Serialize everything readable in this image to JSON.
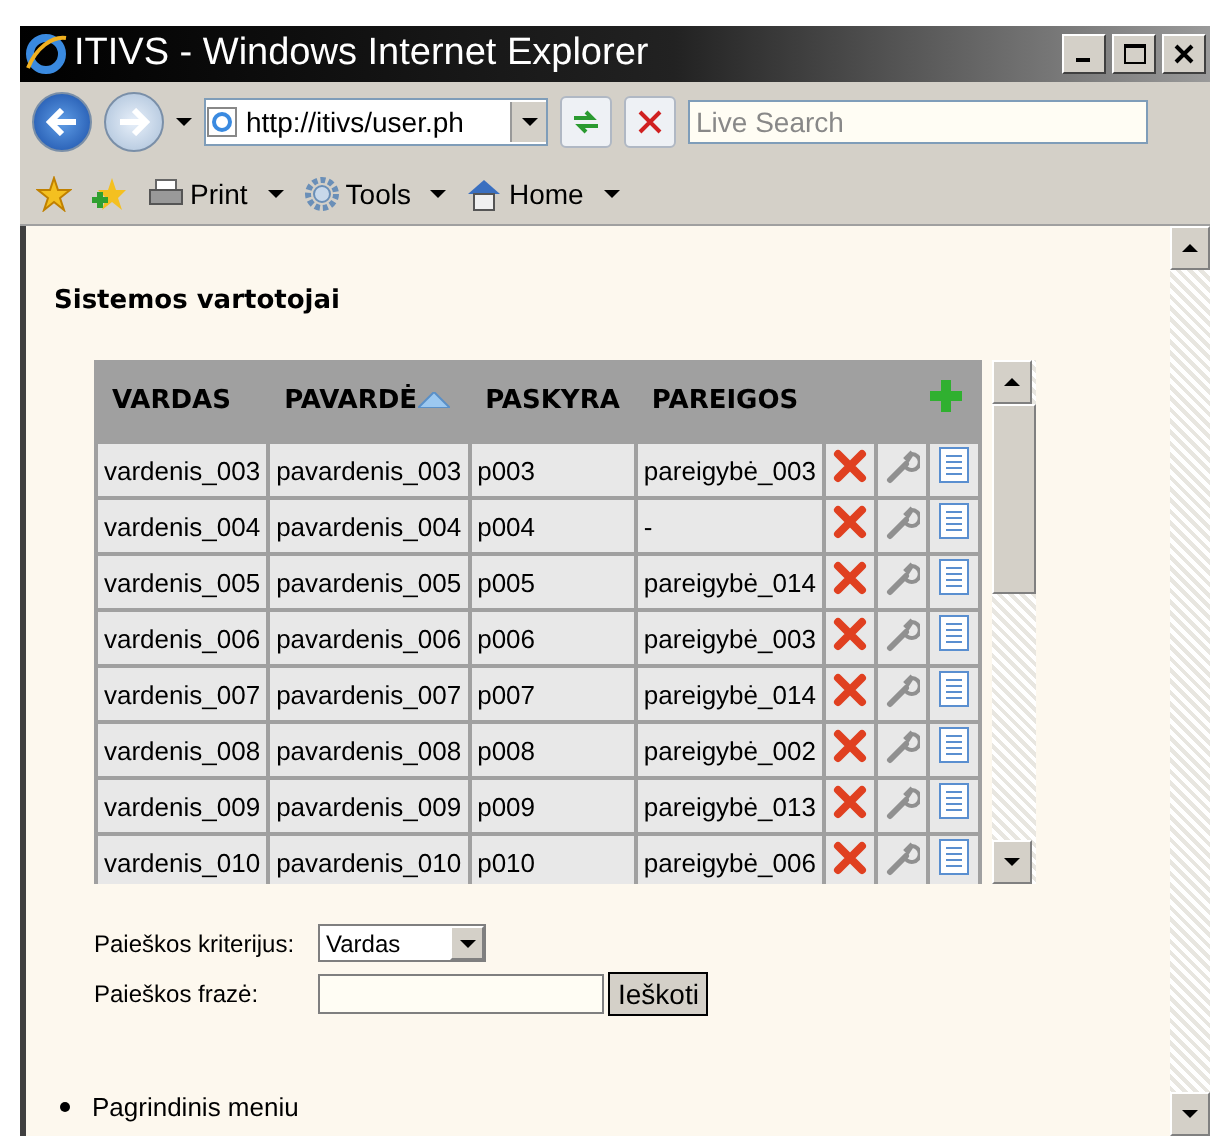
{
  "window": {
    "title": "ITIVS - Windows Internet Explorer"
  },
  "address_bar": {
    "url": "http://itivs/user.ph"
  },
  "search": {
    "placeholder": "Live Search"
  },
  "command_bar": [
    {
      "label": "Print",
      "kind": "print"
    },
    {
      "label": "Tools",
      "kind": "tools"
    },
    {
      "label": "Home",
      "kind": "home"
    }
  ],
  "page": {
    "heading": "Sistemos vartotojai",
    "table": {
      "columns": [
        {
          "label": "VARDAS",
          "sorted": false
        },
        {
          "label": "PAVARDĖ",
          "sorted": true
        },
        {
          "label": "PASKYRA",
          "sorted": false
        },
        {
          "label": "PAREIGOS",
          "sorted": false
        }
      ],
      "rows": [
        [
          "vardenis_003",
          "pavardenis_003",
          "p003",
          "pareigybė_003"
        ],
        [
          "vardenis_004",
          "pavardenis_004",
          "p004",
          "-"
        ],
        [
          "vardenis_005",
          "pavardenis_005",
          "p005",
          "pareigybė_014"
        ],
        [
          "vardenis_006",
          "pavardenis_006",
          "p006",
          "pareigybė_003"
        ],
        [
          "vardenis_007",
          "pavardenis_007",
          "p007",
          "pareigybė_014"
        ],
        [
          "vardenis_008",
          "pavardenis_008",
          "p008",
          "pareigybė_002"
        ],
        [
          "vardenis_009",
          "pavardenis_009",
          "p009",
          "pareigybė_013"
        ],
        [
          "vardenis_010",
          "pavardenis_010",
          "p010",
          "pareigybė_006"
        ]
      ]
    },
    "search_form": {
      "criteria_label": "Paieškos kriterijus:",
      "criteria_value": "Vardas",
      "phrase_label": "Paieškos frazė:",
      "button": "Ieškoti"
    },
    "links": [
      "Pagrindinis meniu"
    ]
  }
}
